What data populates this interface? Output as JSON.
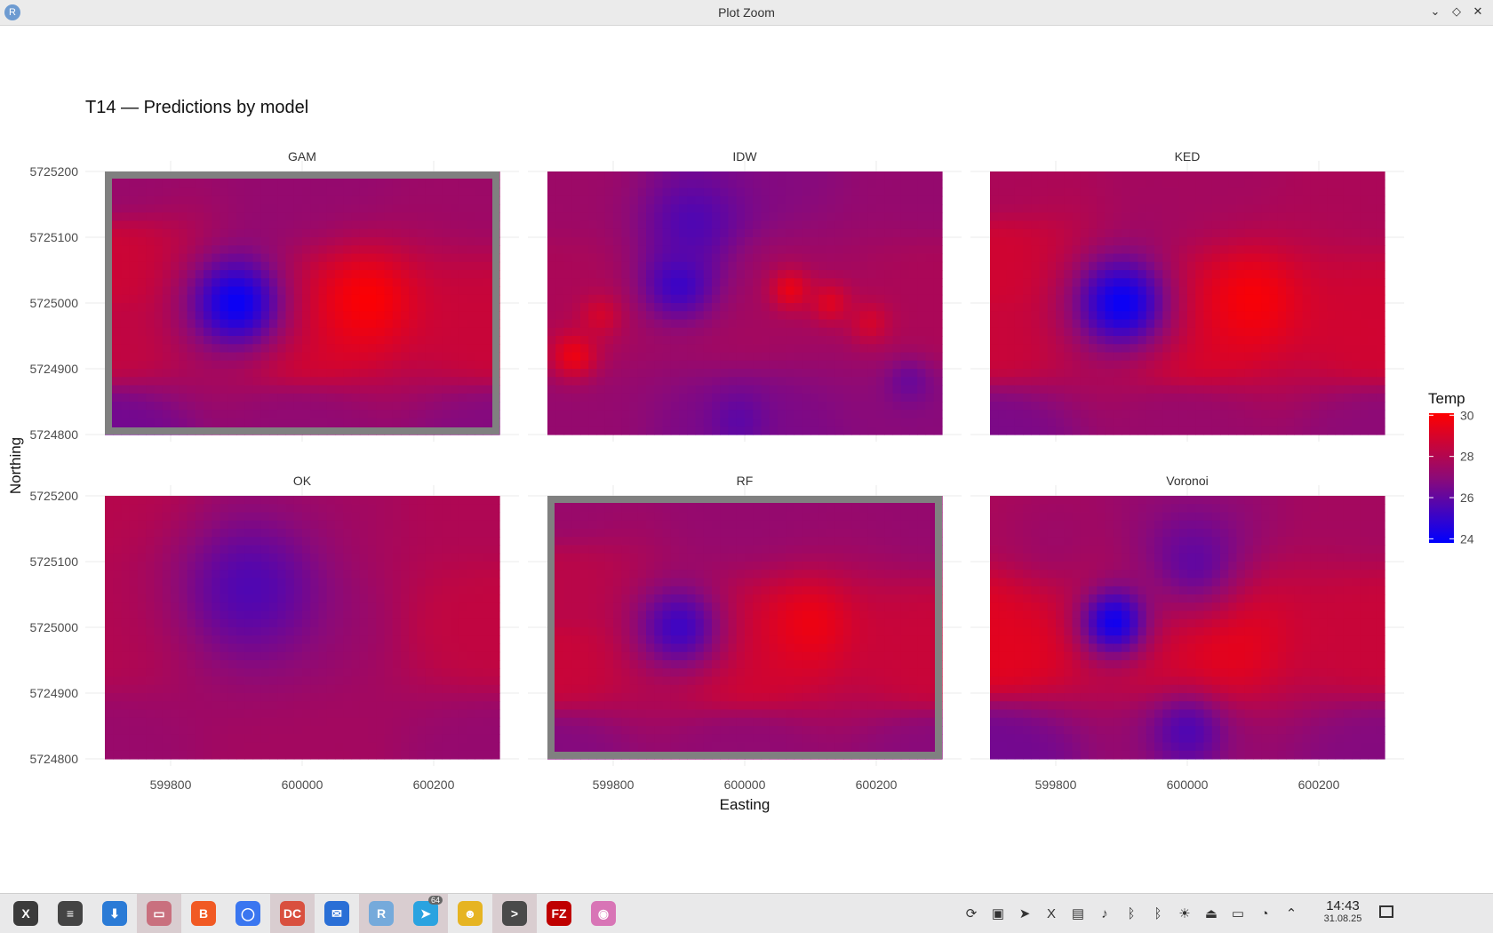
{
  "window": {
    "app_icon": "R",
    "title": "Plot Zoom",
    "controls": [
      "chevron-down-icon",
      "diamond-icon",
      "close-icon"
    ],
    "control_glyphs": [
      "⌄",
      "◇",
      "✕"
    ]
  },
  "chart_data": {
    "type": "heatmap",
    "title": "T14 — Predictions by model",
    "xlabel": "Easting",
    "ylabel": "Northing",
    "xlim": [
      599700,
      600300
    ],
    "ylim": [
      5724800,
      5725200
    ],
    "x_ticks": [
      599800,
      600000,
      600200
    ],
    "x_tick_labels": [
      "599800",
      "600000",
      "600200"
    ],
    "y_ticks": [
      5724800,
      5724900,
      5725000,
      5725100,
      5725200
    ],
    "y_tick_labels": [
      "5724800",
      "5724900",
      "5725000",
      "5725100",
      "5725200"
    ],
    "legend": {
      "title": "Temp",
      "position": "right",
      "range": [
        23.8,
        30.1
      ],
      "ticks": [
        24,
        26,
        28,
        30
      ],
      "tick_labels": [
        "24",
        "26",
        "28",
        "30"
      ],
      "low_color": "#0000ff",
      "mid_color": "#8c0a78",
      "high_color": "#ff0000"
    },
    "grid": true,
    "panels": [
      {
        "name": "GAM",
        "highlighted": true,
        "base": [
          [
            599700,
            5724800,
            26.4
          ],
          [
            599700,
            5724950,
            28.4
          ],
          [
            599700,
            5725050,
            28.7
          ],
          [
            599700,
            5725200,
            27.3
          ],
          [
            600000,
            5724800,
            27.1
          ],
          [
            600000,
            5724950,
            28.9
          ],
          [
            600000,
            5725200,
            27.2
          ],
          [
            600300,
            5724800,
            26.8
          ],
          [
            600300,
            5724950,
            28.6
          ],
          [
            600300,
            5725200,
            27.4
          ]
        ],
        "blobs": [
          [
            599900,
            5725000,
            55,
            24.0
          ],
          [
            600100,
            5725005,
            50,
            30.0
          ]
        ]
      },
      {
        "name": "IDW",
        "highlighted": false,
        "base": [
          [
            599700,
            5724800,
            27.2
          ],
          [
            599700,
            5725000,
            27.8
          ],
          [
            599700,
            5725200,
            27.4
          ],
          [
            600000,
            5724800,
            26.6
          ],
          [
            600000,
            5725000,
            27.6
          ],
          [
            600000,
            5725200,
            26.8
          ],
          [
            600300,
            5724800,
            26.9
          ],
          [
            600300,
            5725000,
            27.8
          ],
          [
            600300,
            5725200,
            27.2
          ]
        ],
        "blobs": [
          [
            599900,
            5725030,
            40,
            25.0
          ],
          [
            599920,
            5725120,
            55,
            25.6
          ],
          [
            600070,
            5725020,
            22,
            29.5
          ],
          [
            600130,
            5725000,
            22,
            29.2
          ],
          [
            599740,
            5724920,
            25,
            29.6
          ],
          [
            599780,
            5724980,
            22,
            28.9
          ],
          [
            600190,
            5724970,
            22,
            28.9
          ],
          [
            599990,
            5724820,
            30,
            25.9
          ],
          [
            600250,
            5724880,
            25,
            26.2
          ]
        ]
      },
      {
        "name": "KED",
        "highlighted": false,
        "base": [
          [
            599700,
            5724800,
            26.6
          ],
          [
            599700,
            5724950,
            28.6
          ],
          [
            599700,
            5725050,
            28.8
          ],
          [
            599700,
            5725200,
            27.8
          ],
          [
            600000,
            5724800,
            27.3
          ],
          [
            600000,
            5724950,
            29.0
          ],
          [
            600000,
            5725200,
            27.6
          ],
          [
            600300,
            5724800,
            27.0
          ],
          [
            600300,
            5724950,
            28.8
          ],
          [
            600300,
            5725200,
            27.8
          ]
        ],
        "blobs": [
          [
            599900,
            5725000,
            55,
            24.0
          ],
          [
            600100,
            5725005,
            50,
            29.9
          ]
        ]
      },
      {
        "name": "OK",
        "highlighted": false,
        "base": [
          [
            599700,
            5724800,
            27.3
          ],
          [
            599700,
            5725000,
            28.0
          ],
          [
            599700,
            5725200,
            28.1
          ],
          [
            600000,
            5724800,
            27.6
          ],
          [
            600000,
            5725000,
            27.4
          ],
          [
            600000,
            5725200,
            27.6
          ],
          [
            600300,
            5724800,
            27.2
          ],
          [
            600300,
            5725000,
            28.4
          ],
          [
            600300,
            5725200,
            27.9
          ]
        ],
        "blobs": [
          [
            599920,
            5725060,
            80,
            25.6
          ]
        ]
      },
      {
        "name": "RF",
        "highlighted": true,
        "base": [
          [
            599700,
            5724800,
            26.8
          ],
          [
            599700,
            5724950,
            28.6
          ],
          [
            599700,
            5725050,
            28.2
          ],
          [
            599700,
            5725200,
            27.3
          ],
          [
            600000,
            5724800,
            27.1
          ],
          [
            600000,
            5724950,
            28.8
          ],
          [
            600000,
            5725200,
            27.2
          ],
          [
            600300,
            5724800,
            26.9
          ],
          [
            600300,
            5724950,
            28.6
          ],
          [
            600300,
            5725200,
            27.2
          ]
        ],
        "blobs": [
          [
            599900,
            5725000,
            50,
            25.2
          ],
          [
            600100,
            5725005,
            45,
            29.6
          ]
        ]
      },
      {
        "name": "Voronoi",
        "highlighted": false,
        "base": [
          [
            599700,
            5724800,
            26.4
          ],
          [
            599700,
            5724980,
            29.3
          ],
          [
            599700,
            5725200,
            27.8
          ],
          [
            600000,
            5724800,
            27.2
          ],
          [
            600000,
            5724980,
            28.8
          ],
          [
            600000,
            5725200,
            27.3
          ],
          [
            600300,
            5724800,
            26.8
          ],
          [
            600300,
            5724980,
            28.6
          ],
          [
            600300,
            5725200,
            27.6
          ]
        ],
        "blobs": [
          [
            599890,
            5725010,
            40,
            23.9
          ],
          [
            600060,
            5724990,
            60,
            29.6
          ],
          [
            600010,
            5725100,
            60,
            26.0
          ],
          [
            600000,
            5724840,
            40,
            25.6
          ],
          [
            599800,
            5725140,
            60,
            27.4
          ]
        ]
      }
    ]
  },
  "taskbar": {
    "apps": [
      {
        "name": "xorg-app",
        "label": "X",
        "color": "#3b3b3b",
        "active": false,
        "badge": ""
      },
      {
        "name": "settings-app",
        "label": "≡",
        "color": "#444444",
        "active": false,
        "badge": ""
      },
      {
        "name": "store-app",
        "label": "⬇",
        "color": "#2b7bd6",
        "active": false,
        "badge": ""
      },
      {
        "name": "files-app",
        "label": "▭",
        "color": "#c9707e",
        "active": true,
        "badge": ""
      },
      {
        "name": "brave-app",
        "label": "B",
        "color": "#f15a24",
        "active": false,
        "badge": ""
      },
      {
        "name": "signal-app",
        "label": "◯",
        "color": "#3a76f0",
        "active": false,
        "badge": ""
      },
      {
        "name": "doublecmd-app",
        "label": "DC",
        "color": "#d9503f",
        "active": true,
        "badge": ""
      },
      {
        "name": "thunderbird-app",
        "label": "✉",
        "color": "#2a6fd6",
        "active": false,
        "badge": ""
      },
      {
        "name": "rstudio-app",
        "label": "R",
        "color": "#75aadb",
        "active": true,
        "badge": ""
      },
      {
        "name": "telegram-app",
        "label": "➤",
        "color": "#2aa3e0",
        "active": true,
        "badge": "64"
      },
      {
        "name": "character-app",
        "label": "☻",
        "color": "#e6b422",
        "active": false,
        "badge": ""
      },
      {
        "name": "terminal-app",
        "label": ">",
        "color": "#4a4a4a",
        "active": true,
        "badge": ""
      },
      {
        "name": "filezilla-app",
        "label": "FZ",
        "color": "#bf0000",
        "active": false,
        "badge": ""
      },
      {
        "name": "eye-app",
        "label": "◉",
        "color": "#d875b6",
        "active": false,
        "badge": ""
      }
    ],
    "tray": [
      {
        "name": "sync-icon",
        "glyph": "⟳"
      },
      {
        "name": "screenshot-icon",
        "glyph": "▣"
      },
      {
        "name": "telegram-tray-icon",
        "glyph": "➤"
      },
      {
        "name": "xapp-tray-icon",
        "glyph": "X"
      },
      {
        "name": "clipboard-icon",
        "glyph": "▤"
      },
      {
        "name": "volume-icon",
        "glyph": "♪"
      },
      {
        "name": "bluetooth-icon",
        "glyph": "ᛒ"
      },
      {
        "name": "bluetooth-alt-icon",
        "glyph": "ᛒ"
      },
      {
        "name": "brightness-icon",
        "glyph": "☀"
      },
      {
        "name": "usb-icon",
        "glyph": "⏏"
      },
      {
        "name": "network-icon",
        "glyph": "▭"
      },
      {
        "name": "wifi-icon",
        "glyph": "◔"
      },
      {
        "name": "chevron-up-icon",
        "glyph": "⌃"
      }
    ],
    "clock_time": "14:43",
    "clock_date": "31.08.25"
  }
}
